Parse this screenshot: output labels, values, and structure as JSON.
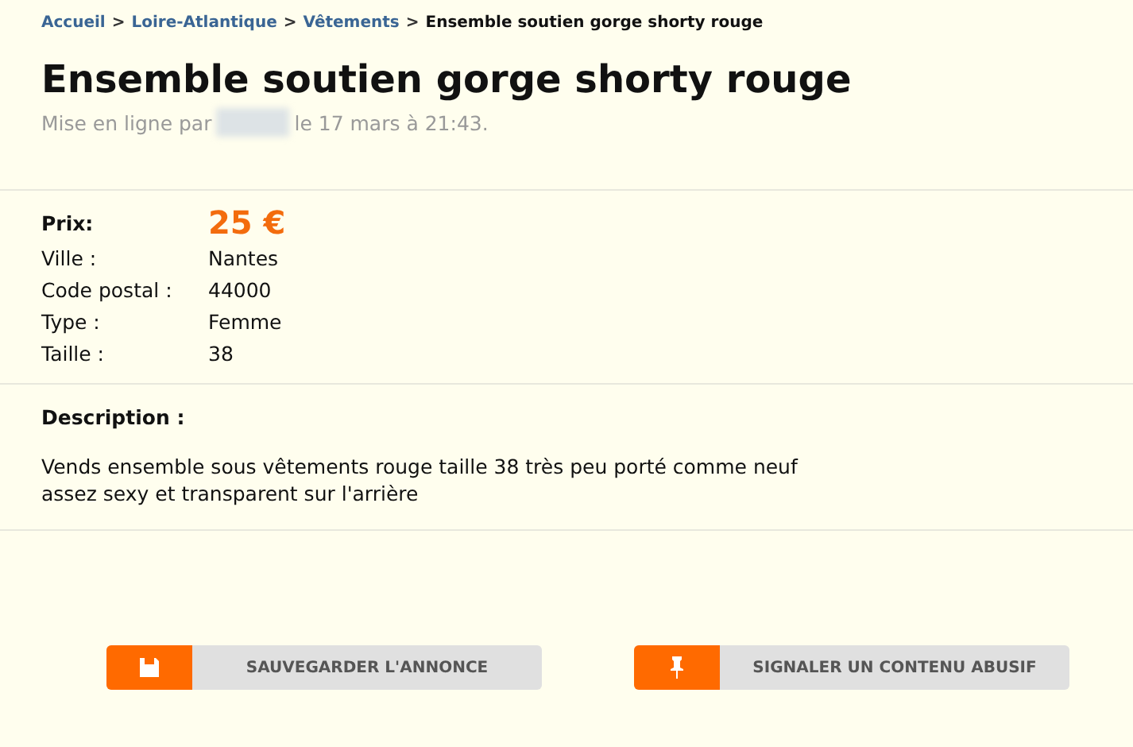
{
  "breadcrumb": [
    {
      "label": "Accueil",
      "link": true
    },
    {
      "label": "Loire-Atlantique",
      "link": true
    },
    {
      "label": "Vêtements",
      "link": true
    },
    {
      "label": "Ensemble soutien gorge shorty rouge",
      "link": false
    }
  ],
  "breadcrumb_separator": ">",
  "title": "Ensemble soutien gorge shorty rouge",
  "posted": {
    "before": "Mise en ligne par",
    "after": "le 17 mars à 21:43."
  },
  "price": {
    "label": "Prix:",
    "value": "25 €"
  },
  "details": [
    {
      "label": "Ville :",
      "value": "Nantes"
    },
    {
      "label": "Code postal :",
      "value": "44000"
    },
    {
      "label": "Type :",
      "value": "Femme"
    },
    {
      "label": "Taille :",
      "value": "38"
    }
  ],
  "description": {
    "label": "Description :",
    "text": "Vends ensemble sous vêtements rouge taille 38 très peu porté comme neuf assez sexy et transparent sur l'arrière"
  },
  "buttons": [
    {
      "kind": "save",
      "label": "SAUVEGARDER L'ANNONCE"
    },
    {
      "kind": "report",
      "label": "SIGNALER UN CONTENU ABUSIF"
    }
  ]
}
